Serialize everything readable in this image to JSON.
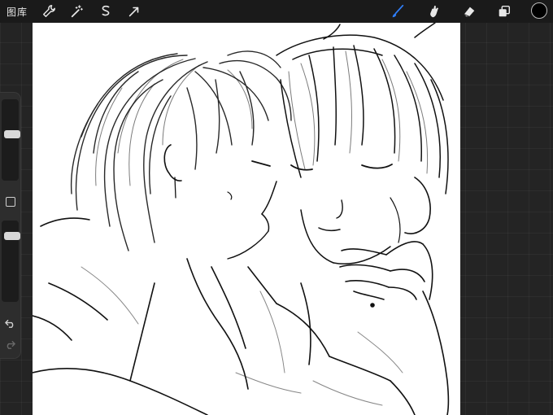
{
  "topbar": {
    "gallery_label": "图库",
    "left_tools": [
      "wrench-icon",
      "magic-wand-icon",
      "selection-icon",
      "transform-arrow-icon"
    ],
    "right_tools": [
      "brush-icon",
      "smudge-icon",
      "eraser-icon",
      "layers-icon"
    ],
    "active_tool": "brush",
    "accent_color": "#2f7df6"
  },
  "color": {
    "current": "#000000"
  },
  "sidebar": {
    "brush_size_level": 0.42,
    "opacity_level": 0.15
  },
  "canvas": {
    "background": "#ffffff",
    "stroke_color": "#111111"
  }
}
